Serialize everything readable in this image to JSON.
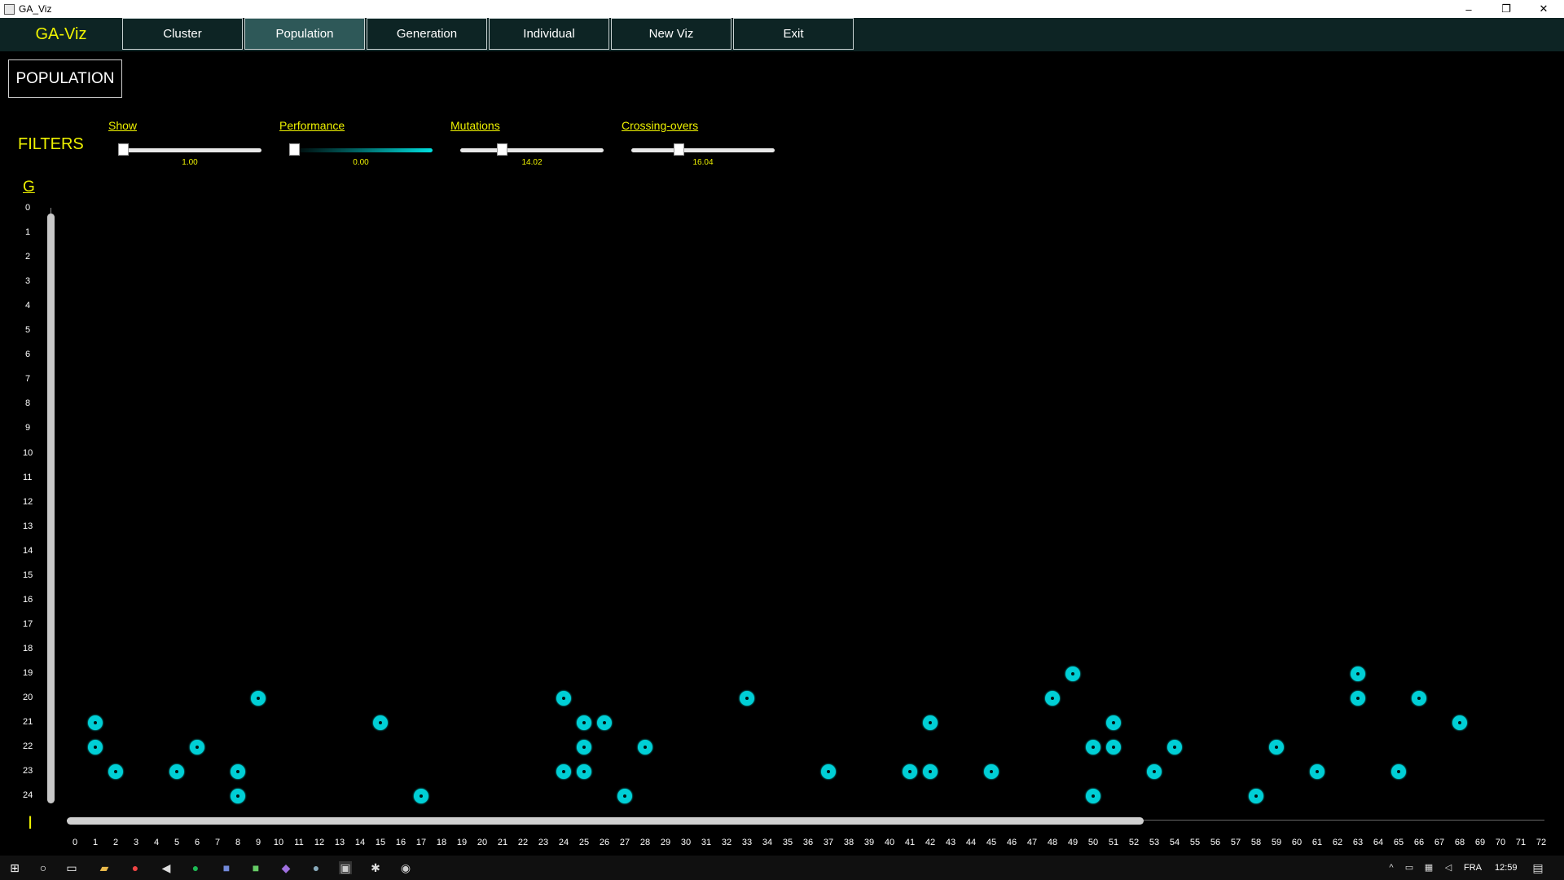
{
  "window": {
    "title": "GA_Viz",
    "minimize": "–",
    "restore": "❐",
    "close": "✕"
  },
  "menu": {
    "app_name": "GA-Viz",
    "items": [
      {
        "label": "Cluster",
        "active": false
      },
      {
        "label": "Population",
        "active": true
      },
      {
        "label": "Generation",
        "active": false
      },
      {
        "label": "Individual",
        "active": false
      },
      {
        "label": "New Viz",
        "active": false
      },
      {
        "label": "Exit",
        "active": false
      }
    ]
  },
  "page": {
    "title": "POPULATION"
  },
  "filters": {
    "label": "FILTERS",
    "sliders": [
      {
        "label": "Show",
        "value": "1.00",
        "fraction": 0.0
      },
      {
        "label": "Performance",
        "value": "0.00",
        "fraction": 0.0
      },
      {
        "label": "Mutations",
        "value": "14.02",
        "fraction": 0.29
      },
      {
        "label": "Crossing-overs",
        "value": "16.04",
        "fraction": 0.33
      }
    ]
  },
  "chart_data": {
    "type": "scatter",
    "ylabel": "G",
    "xlabel": "I",
    "y_ticks": [
      0,
      1,
      2,
      3,
      4,
      5,
      6,
      7,
      8,
      9,
      10,
      11,
      12,
      13,
      14,
      15,
      16,
      17,
      18,
      19,
      20,
      21,
      22,
      23,
      24
    ],
    "x_ticks": [
      0,
      1,
      2,
      3,
      4,
      5,
      6,
      7,
      8,
      9,
      10,
      11,
      12,
      13,
      14,
      15,
      16,
      17,
      18,
      19,
      20,
      21,
      22,
      23,
      24,
      25,
      26,
      27,
      28,
      29,
      30,
      31,
      32,
      33,
      34,
      35,
      36,
      37,
      38,
      39,
      40,
      41,
      42,
      43,
      44,
      45,
      46,
      47,
      48,
      49,
      50,
      51,
      52,
      53,
      54,
      55,
      56,
      57,
      58,
      59,
      60,
      61,
      62,
      63,
      64,
      65,
      66,
      67,
      68,
      69,
      70,
      71,
      72
    ],
    "points": [
      [
        1,
        21
      ],
      [
        1,
        22
      ],
      [
        2,
        23
      ],
      [
        5,
        23
      ],
      [
        6,
        22
      ],
      [
        8,
        23
      ],
      [
        8,
        24
      ],
      [
        9,
        20
      ],
      [
        15,
        21
      ],
      [
        17,
        24
      ],
      [
        24,
        20
      ],
      [
        24,
        23
      ],
      [
        25,
        21
      ],
      [
        25,
        22
      ],
      [
        25,
        23
      ],
      [
        26,
        21
      ],
      [
        27,
        24
      ],
      [
        28,
        22
      ],
      [
        33,
        20
      ],
      [
        37,
        23
      ],
      [
        41,
        23
      ],
      [
        42,
        21
      ],
      [
        42,
        23
      ],
      [
        45,
        23
      ],
      [
        48,
        20
      ],
      [
        49,
        19
      ],
      [
        50,
        22
      ],
      [
        50,
        24
      ],
      [
        51,
        21
      ],
      [
        51,
        22
      ],
      [
        53,
        23
      ],
      [
        54,
        22
      ],
      [
        58,
        24
      ],
      [
        59,
        22
      ],
      [
        61,
        23
      ],
      [
        63,
        19
      ],
      [
        63,
        20
      ],
      [
        65,
        23
      ],
      [
        66,
        20
      ],
      [
        68,
        21
      ]
    ]
  },
  "taskbar": {
    "language": "FRA",
    "time": "12:59"
  }
}
